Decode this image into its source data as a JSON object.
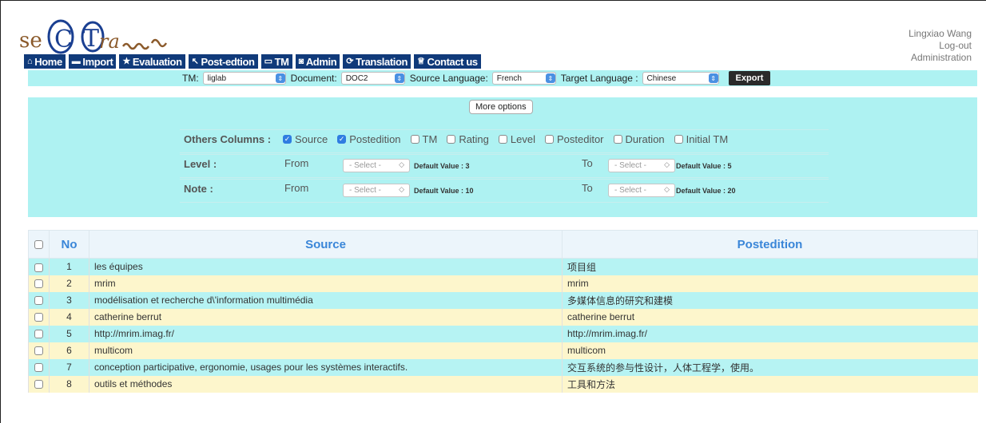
{
  "logo": {
    "text": "seCTra_w"
  },
  "user": {
    "name": "Lingxiao Wang",
    "logout": "Log-out",
    "admin": "Administration"
  },
  "nav": [
    {
      "icon": "home-icon",
      "glyph": "⌂",
      "label": "Home"
    },
    {
      "icon": "import-icon",
      "glyph": "▬",
      "label": "Import"
    },
    {
      "icon": "star-icon",
      "glyph": "★",
      "label": "Evaluation"
    },
    {
      "icon": "pin-icon",
      "glyph": "↖",
      "label": "Post-edtion"
    },
    {
      "icon": "book-icon",
      "glyph": "▭",
      "label": "TM"
    },
    {
      "icon": "camera-icon",
      "glyph": "◙",
      "label": "Admin"
    },
    {
      "icon": "translate-icon",
      "glyph": "⟳",
      "label": "Translation"
    },
    {
      "icon": "trophy-icon",
      "glyph": "♕",
      "label": "Contact us"
    }
  ],
  "toolbar": {
    "tm_label": "TM:",
    "tm_value": "liglab",
    "doc_label": "Document:",
    "doc_value": "DOC2",
    "src_label": "Source Language:",
    "src_value": "French",
    "tgt_label": "Target Language :",
    "tgt_value": "Chinese",
    "export": "Export"
  },
  "options": {
    "more": "More options",
    "columns_label": "Others Columns :",
    "columns": [
      {
        "label": "Source",
        "checked": true
      },
      {
        "label": "Postedition",
        "checked": true
      },
      {
        "label": "TM",
        "checked": false
      },
      {
        "label": "Rating",
        "checked": false
      },
      {
        "label": "Level",
        "checked": false
      },
      {
        "label": "Posteditor",
        "checked": false
      },
      {
        "label": "Duration",
        "checked": false
      },
      {
        "label": "Initial TM",
        "checked": false
      }
    ],
    "level": {
      "label": "Level :",
      "from": "From",
      "to": "To",
      "select": "- Select -",
      "default_from": "Default Value : 3",
      "default_to": "Default Value : 5"
    },
    "note": {
      "label": "Note :",
      "from": "From",
      "to": "To",
      "select": "- Select -",
      "default_from": "Default Value : 10",
      "default_to": "Default Value : 20"
    }
  },
  "table": {
    "headers": {
      "no": "No",
      "source": "Source",
      "postedition": "Postedition"
    },
    "rows": [
      {
        "no": "1",
        "source": "les équipes",
        "post": "项目组"
      },
      {
        "no": "2",
        "source": "mrim",
        "post": "mrim"
      },
      {
        "no": "3",
        "source": "modélisation et recherche d\\'information multimédia",
        "post": "多媒体信息的研究和建模"
      },
      {
        "no": "4",
        "source": "catherine berrut",
        "post": "catherine berrut"
      },
      {
        "no": "5",
        "source": "http://mrim.imag.fr/",
        "post": "http://mrim.imag.fr/"
      },
      {
        "no": "6",
        "source": "multicom",
        "post": "multicom"
      },
      {
        "no": "7",
        "source": "conception participative, ergonomie, usages pour les systèmes interactifs.",
        "post": "交互系统的参与性设计，人体工程学，使用。"
      },
      {
        "no": "8",
        "source": "outils et méthodes",
        "post": "工具和方法"
      }
    ]
  }
}
